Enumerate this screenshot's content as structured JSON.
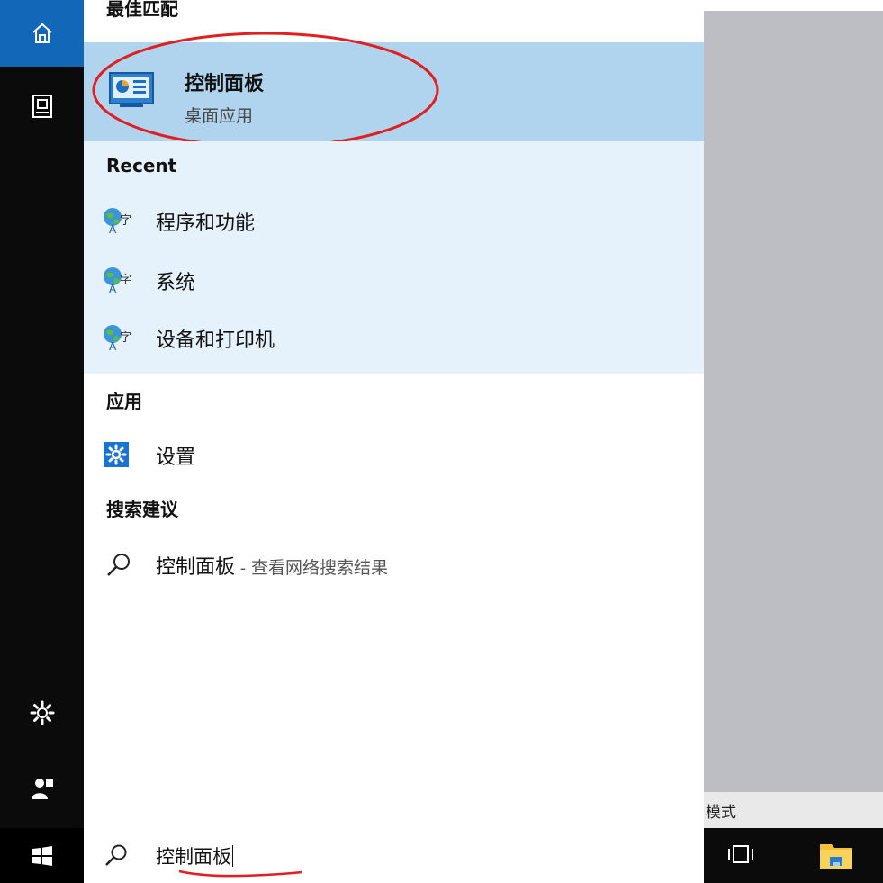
{
  "sidebar": {
    "home_icon": "home-icon",
    "docs_icon": "document-icon",
    "settings_icon": "gear-icon",
    "user_icon": "user-icon",
    "start_icon": "windows-logo-icon"
  },
  "results": {
    "best_match_header": "最佳匹配",
    "best_match": {
      "title": "控制面板",
      "subtitle": "桌面应用",
      "icon": "control-panel-icon"
    },
    "recent_header": "Recent",
    "recent_items": [
      {
        "label": "程序和功能"
      },
      {
        "label": "系统"
      },
      {
        "label": "设备和打印机"
      }
    ],
    "apps_header": "应用",
    "apps_items": [
      {
        "label": "设置"
      }
    ],
    "suggestions_header": "搜索建议",
    "suggestion": {
      "query": "控制面板",
      "separator": " - ",
      "rest": "查看网络搜索结果"
    }
  },
  "search": {
    "value": "控制面板"
  },
  "taskbar": {
    "mode_hint": "模式"
  },
  "colors": {
    "accent": "#1367b8",
    "best_match_bg": "#b0d3ee",
    "recent_bg": "#e5f1fb",
    "annotation_red": "#e02020"
  }
}
